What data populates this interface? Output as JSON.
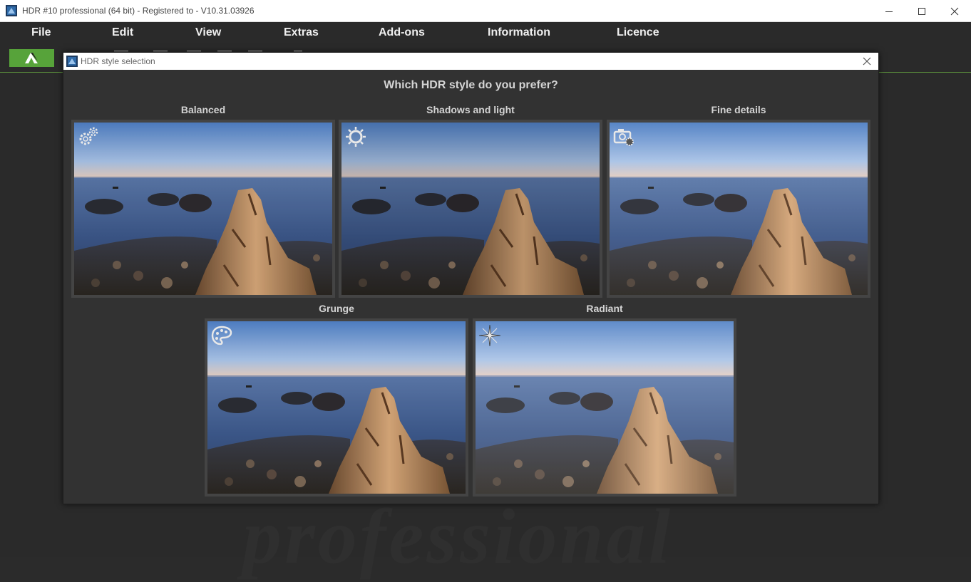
{
  "window": {
    "title": "HDR #10 professional (64 bit) - Registered to - V10.31.03926"
  },
  "menu": [
    "File",
    "Edit",
    "View",
    "Extras",
    "Add-ons",
    "Information",
    "Licence"
  ],
  "watermark": "professional",
  "dialog": {
    "title": "HDR style selection",
    "question": "Which HDR style do you prefer?",
    "styles": [
      {
        "label": "Balanced",
        "icon": "gears-icon",
        "tint": "#3c5c8f"
      },
      {
        "label": "Shadows and light",
        "icon": "sun-icon",
        "tint": "#3a5e9a"
      },
      {
        "label": "Fine details",
        "icon": "camera-settings-icon",
        "tint": "#3d6296"
      },
      {
        "label": "Grunge",
        "icon": "palette-icon",
        "tint": "#3b5f92"
      },
      {
        "label": "Radiant",
        "icon": "sparkle-icon",
        "tint": "#4a6fa6"
      }
    ]
  },
  "colors": {
    "accent_green": "#57a33a",
    "background": "#2a2a2a",
    "dialog_bg": "#323232"
  }
}
